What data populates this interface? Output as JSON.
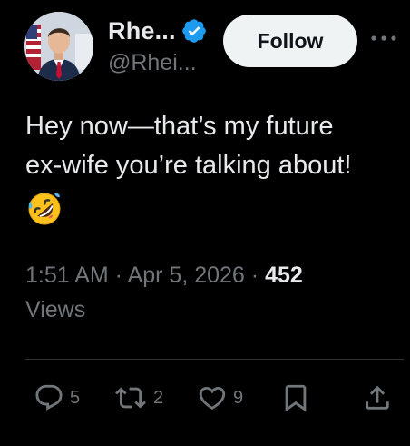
{
  "author": {
    "display_name": "Rhe...",
    "handle": "@Rhei...",
    "verified_color": "#1d9bf0",
    "avatar_icon": "profile-photo"
  },
  "follow_button": {
    "label": "Follow"
  },
  "more_icon": "more-horizontal-icon",
  "tweet": {
    "text_line1": "Hey now—that’s my future",
    "text_line2": "ex-wife you’re talking about!",
    "emoji": "rolling-on-floor-laughing-emoji"
  },
  "meta": {
    "time": "1:51 AM",
    "sep1": " · ",
    "date": "Apr 5, 2026",
    "sep2": " · ",
    "views_count": "452",
    "views_label": "Views"
  },
  "actions": {
    "replies": {
      "icon": "reply-icon",
      "count": "5"
    },
    "reposts": {
      "icon": "repost-icon",
      "count": "2"
    },
    "likes": {
      "icon": "heart-icon",
      "count": "9"
    },
    "bookmark": {
      "icon": "bookmark-icon"
    },
    "share": {
      "icon": "share-icon"
    }
  },
  "colors": {
    "background": "#000000",
    "text_primary": "#e7e9ea",
    "text_secondary": "#71767b",
    "divider": "#2f3336",
    "follow_bg": "#eff3f4"
  }
}
